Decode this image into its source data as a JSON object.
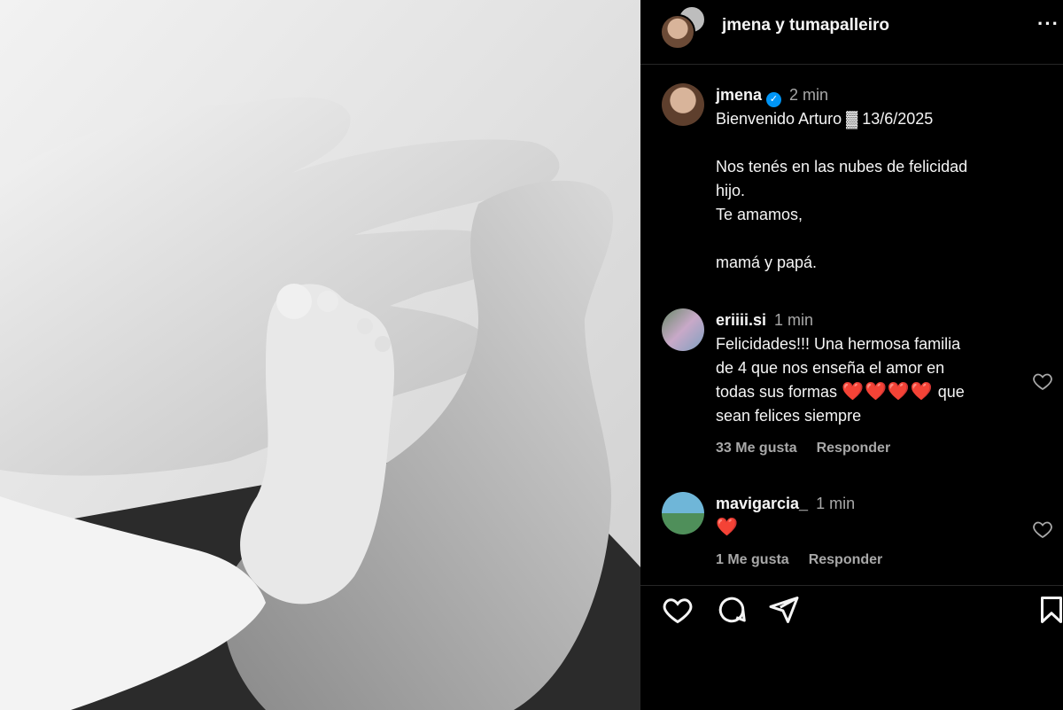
{
  "header": {
    "title": "jmena y tumapalleiro",
    "more_icon": "more-horizontal-icon"
  },
  "post": {
    "username": "jmena",
    "verified": true,
    "time": "2 min",
    "caption": {
      "line1": "Bienvenido Arturo ▓ 13/6/2025",
      "line2": "Nos tenés en las nubes de felicidad",
      "line3": "hijo.",
      "line4": "Te amamos,",
      "line5": "mamá y papá."
    }
  },
  "comments": [
    {
      "username": "eriiii.si",
      "time": "1 min",
      "line1": "Felicidades!!! Una hermosa familia",
      "line2": "de 4 que nos enseña el amor en",
      "line3a": "todas sus formas",
      "line3_hearts": "❤️❤️❤️❤️",
      "line3b": "que",
      "line4": "sean felices siempre",
      "likes": "33 Me gusta",
      "reply": "Responder"
    },
    {
      "username": "mavigarcia_",
      "time": "1 min",
      "text": "❤️",
      "likes": "1 Me gusta",
      "reply": "Responder"
    }
  ],
  "actions": {
    "icons": [
      "heart-icon",
      "comment-icon",
      "share-icon",
      "bookmark-icon"
    ]
  },
  "colors": {
    "background": "#000000",
    "text": "#f5f5f5",
    "muted": "#a8a8a8",
    "verified": "#0095f6",
    "heart_red": "#e53935"
  }
}
